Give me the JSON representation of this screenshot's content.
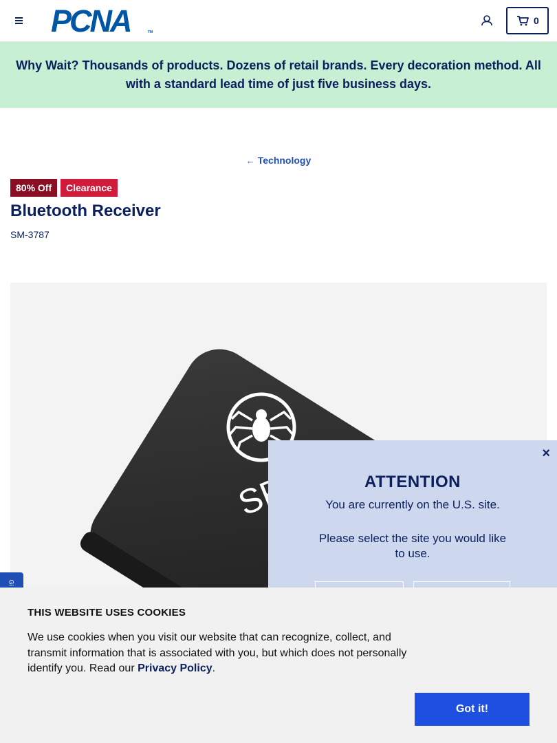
{
  "header": {
    "logo_text": "PCNA",
    "logo_tm": "TM",
    "cart_count": "0",
    "icons": [
      "menu-icon",
      "user-icon",
      "cart-icon"
    ]
  },
  "promo": {
    "text": "Why Wait? Thousands of products. Dozens of retail brands. Every decoration method. All with a standard lead time of just five business days."
  },
  "breadcrumb": {
    "label": "Technology"
  },
  "product": {
    "badge_discount": "80% Off",
    "badge_status": "Clearance",
    "title": "Bluetooth Receiver",
    "sku": "SM-3787",
    "image_brand_text": "SP"
  },
  "region_modal": {
    "close_label": "×",
    "heading": "ATTENTION",
    "line1": "You are currently on the U.S. site.",
    "line2": "Please select the site you would like to use."
  },
  "side_tab": {
    "label": "Gi"
  },
  "cookie_banner": {
    "heading": "THIS WEBSITE USES COOKIES",
    "body": "We use cookies when you visit our website that can recognize, collect, and transmit information that is associated with you, but which does not personally identify you. Read our ",
    "link_label": "Privacy Policy",
    "body_end": ".",
    "accept_label": "Got it!"
  },
  "colors": {
    "navy": "#0b1f5c",
    "brand_blue": "#0055a5",
    "promo_bg": "#c6efd3",
    "badge_discount": "#8a0e24",
    "badge_clearance": "#d11b3a",
    "modal_bg": "#cdd8ee",
    "accept_button": "#1f4fe0"
  }
}
